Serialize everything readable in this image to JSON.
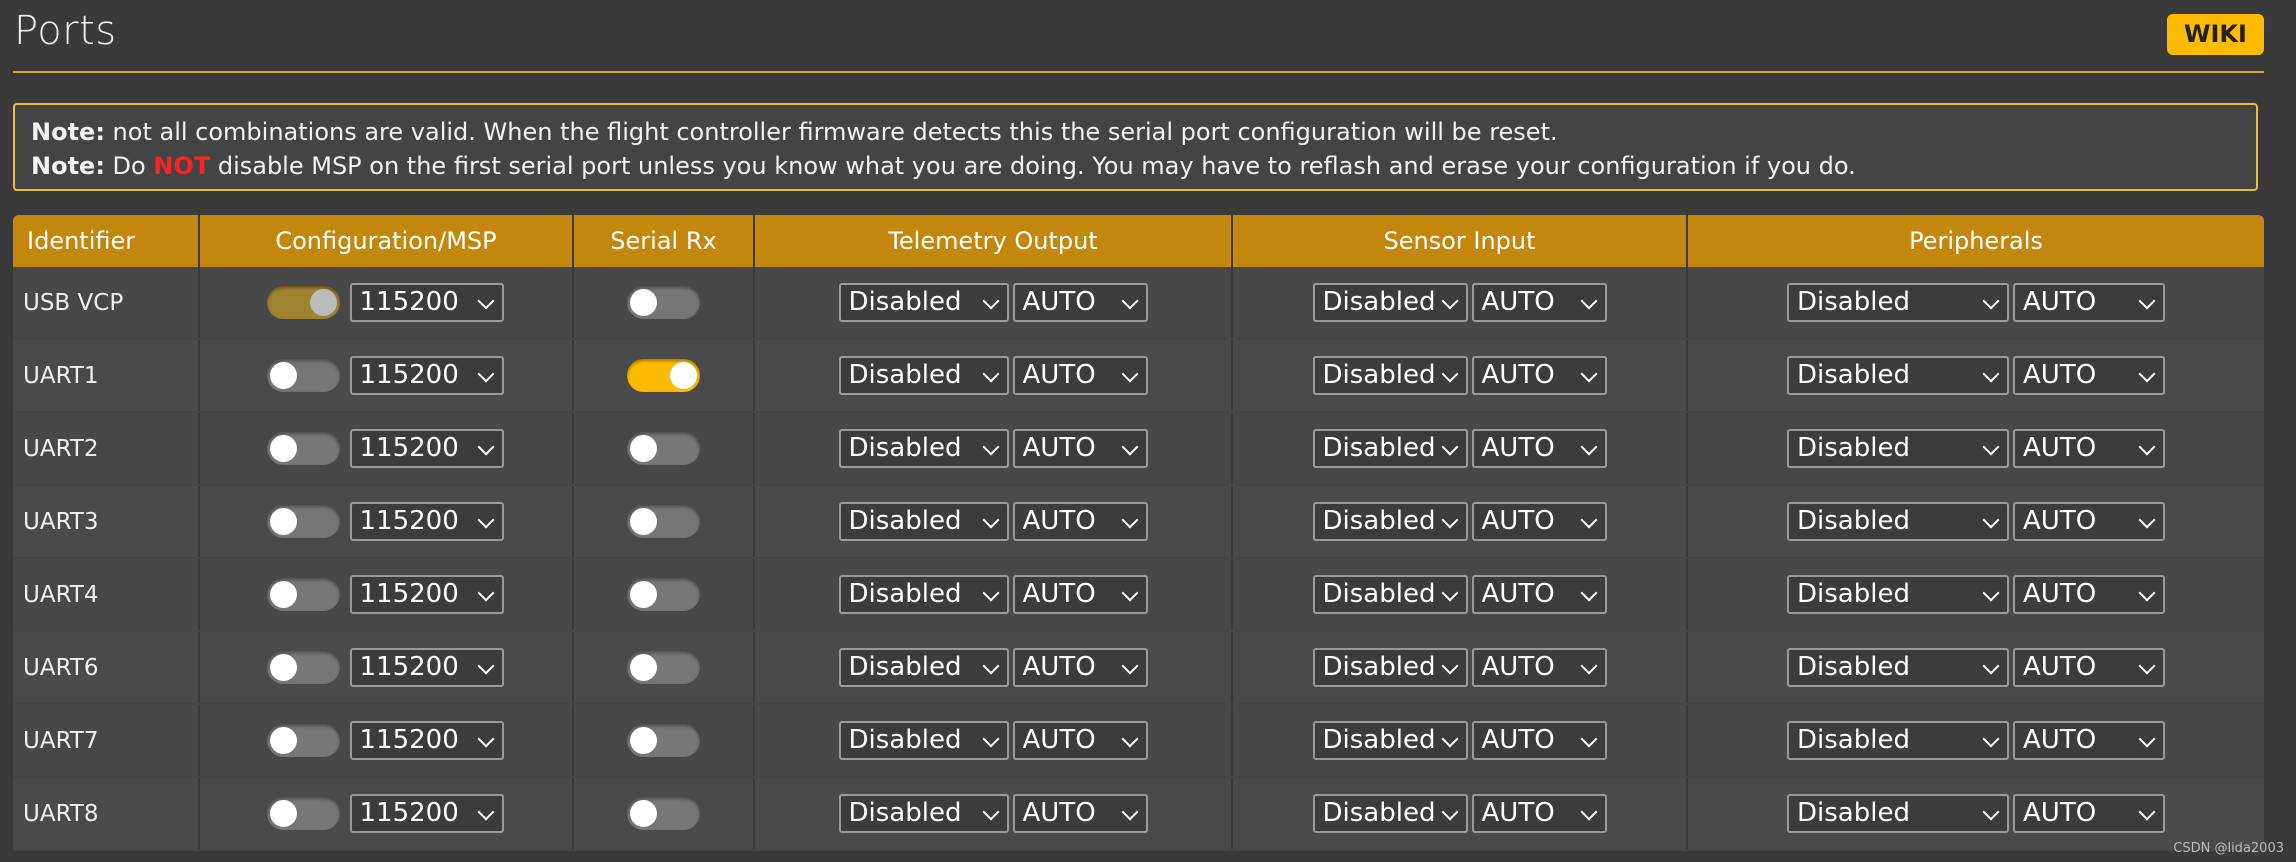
{
  "header": {
    "title": "Ports",
    "wiki_label": "WIKI"
  },
  "notes": [
    {
      "label": "Note:",
      "text": " not all combinations are valid. When the flight controller firmware detects this the serial port configuration will be reset."
    },
    {
      "label": "Note:",
      "pre": " Do ",
      "emphasis": "NOT",
      "post": " disable MSP on the first serial port unless you know what you are doing. You may have to reflash and erase your configuration if you do."
    }
  ],
  "columns": [
    "Identifier",
    "Configuration/MSP",
    "Serial Rx",
    "Telemetry Output",
    "Sensor Input",
    "Peripherals"
  ],
  "rows": [
    {
      "id": "USB VCP",
      "msp": true,
      "msp_locked": true,
      "baud": "115200",
      "serial_rx": false,
      "telemetry": "Disabled",
      "telemetry_baud": "AUTO",
      "sensor": "Disabled",
      "sensor_baud": "AUTO",
      "peripheral": "Disabled",
      "peripheral_baud": "AUTO"
    },
    {
      "id": "UART1",
      "msp": false,
      "baud": "115200",
      "serial_rx": true,
      "telemetry": "Disabled",
      "telemetry_baud": "AUTO",
      "sensor": "Disabled",
      "sensor_baud": "AUTO",
      "peripheral": "Disabled",
      "peripheral_baud": "AUTO"
    },
    {
      "id": "UART2",
      "msp": false,
      "baud": "115200",
      "serial_rx": false,
      "telemetry": "Disabled",
      "telemetry_baud": "AUTO",
      "sensor": "Disabled",
      "sensor_baud": "AUTO",
      "peripheral": "Disabled",
      "peripheral_baud": "AUTO"
    },
    {
      "id": "UART3",
      "msp": false,
      "baud": "115200",
      "serial_rx": false,
      "telemetry": "Disabled",
      "telemetry_baud": "AUTO",
      "sensor": "Disabled",
      "sensor_baud": "AUTO",
      "peripheral": "Disabled",
      "peripheral_baud": "AUTO"
    },
    {
      "id": "UART4",
      "msp": false,
      "baud": "115200",
      "serial_rx": false,
      "telemetry": "Disabled",
      "telemetry_baud": "AUTO",
      "sensor": "Disabled",
      "sensor_baud": "AUTO",
      "peripheral": "Disabled",
      "peripheral_baud": "AUTO"
    },
    {
      "id": "UART6",
      "msp": false,
      "baud": "115200",
      "serial_rx": false,
      "telemetry": "Disabled",
      "telemetry_baud": "AUTO",
      "sensor": "Disabled",
      "sensor_baud": "AUTO",
      "peripheral": "Disabled",
      "peripheral_baud": "AUTO"
    },
    {
      "id": "UART7",
      "msp": false,
      "baud": "115200",
      "serial_rx": false,
      "telemetry": "Disabled",
      "telemetry_baud": "AUTO",
      "sensor": "Disabled",
      "sensor_baud": "AUTO",
      "peripheral": "Disabled",
      "peripheral_baud": "AUTO"
    },
    {
      "id": "UART8",
      "msp": false,
      "baud": "115200",
      "serial_rx": false,
      "telemetry": "Disabled",
      "telemetry_baud": "AUTO",
      "sensor": "Disabled",
      "sensor_baud": "AUTO",
      "peripheral": "Disabled",
      "peripheral_baud": "AUTO"
    }
  ],
  "icons": {
    "select_arrow": "chevron-down-icon"
  },
  "colors": {
    "accent": "#ffbb00",
    "header_bg": "#c4870e",
    "note_border": "#e6c23a",
    "warning_red": "#ff2222",
    "background": "#3a3a3a"
  },
  "watermark": "CSDN @lida2003"
}
